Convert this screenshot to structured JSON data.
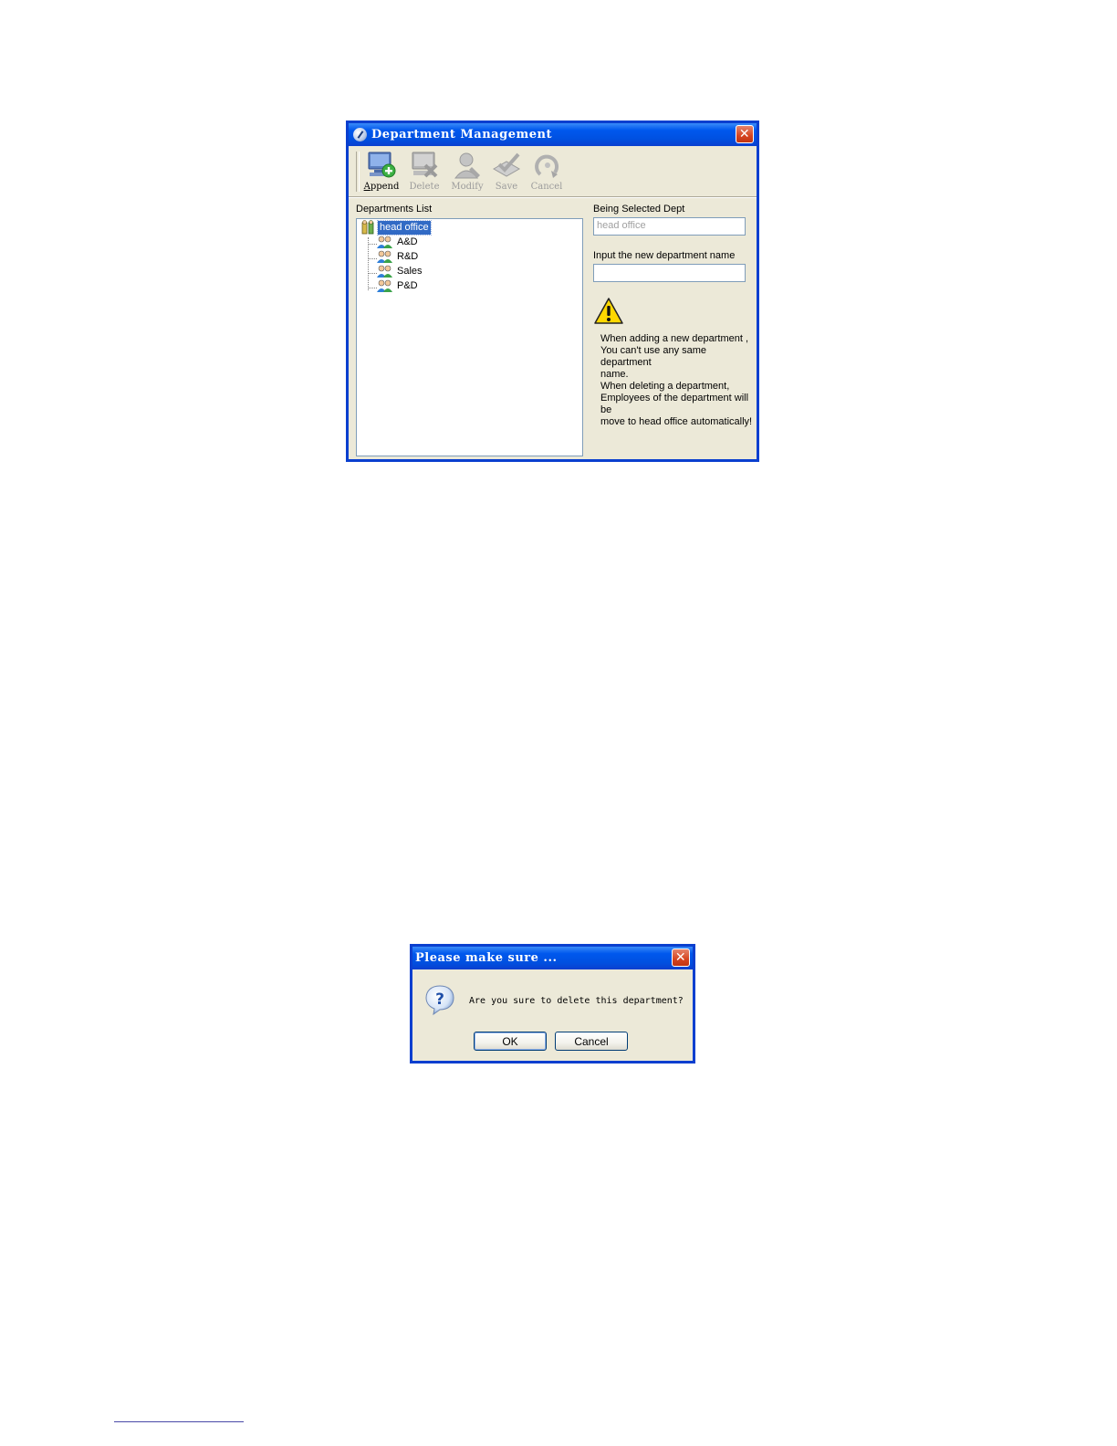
{
  "dept_window": {
    "title": "Department Management",
    "toolbar": [
      {
        "label": "Append",
        "icon": "append-icon",
        "enabled": true
      },
      {
        "label": "Delete",
        "icon": "delete-icon",
        "enabled": false
      },
      {
        "label": "Modify",
        "icon": "modify-icon",
        "enabled": false
      },
      {
        "label": "Save",
        "icon": "save-icon",
        "enabled": false
      },
      {
        "label": "Cancel",
        "icon": "cancel-icon",
        "enabled": false
      }
    ],
    "list_label": "Departments List",
    "tree": {
      "root": "head office",
      "children": [
        "A&D",
        "R&D",
        "Sales",
        "P&D"
      ]
    },
    "selected_label": "Being Selected Dept",
    "selected_value": "head office",
    "new_name_label": "Input the new department name",
    "new_name_value": "",
    "note_lines": [
      "When adding a new department ,",
      "You can't use any same department",
      "name.",
      "When deleting a department,",
      "Employees of the department will be",
      "move to head office automatically!"
    ]
  },
  "confirm_dialog": {
    "title": "Please make sure ...",
    "message": "Are you sure to delete this department?",
    "ok_label": "OK",
    "cancel_label": "Cancel"
  },
  "colors": {
    "titlebar": "#0058ee",
    "window_bg": "#ece9d8",
    "selection": "#316ac5",
    "warning": "#ffd800"
  }
}
